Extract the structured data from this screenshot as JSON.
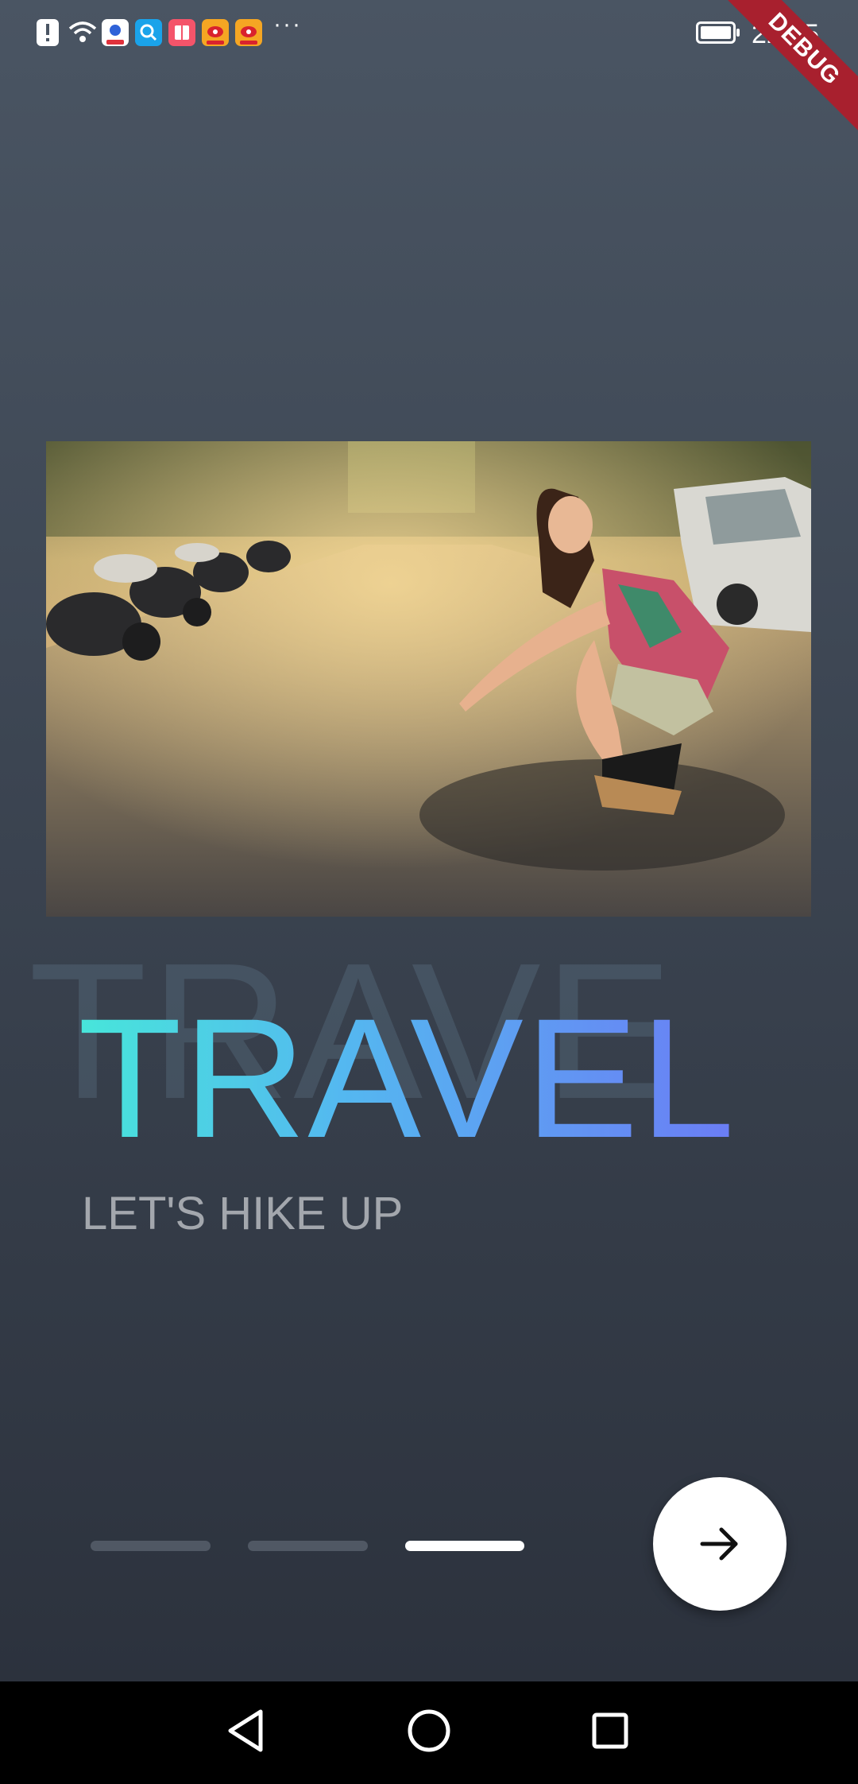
{
  "status_bar": {
    "time": "22:55",
    "notification_icons": [
      "alert-icon",
      "wifi-icon",
      "baidu-icon",
      "search-app-icon",
      "book-app-icon",
      "weibo-icon",
      "weibo-icon"
    ],
    "overflow": "···"
  },
  "debug_banner": "DEBUG",
  "hero": {
    "title": "TRAVEL",
    "title_ghost": "TRAVE",
    "subtitle": "LET'S HIKE UP"
  },
  "pager": {
    "pages": 3,
    "active_index": 2,
    "inactive_color": "#505864",
    "active_color": "#ffffff"
  },
  "next_button": {
    "icon": "arrow-right-icon"
  },
  "nav_bar": {
    "buttons": [
      "back-icon",
      "home-icon",
      "recents-icon"
    ]
  },
  "colors": {
    "title_gradient_start": "#47e6da",
    "title_gradient_end": "#6b7cf5",
    "debug_red": "#a8202e"
  }
}
